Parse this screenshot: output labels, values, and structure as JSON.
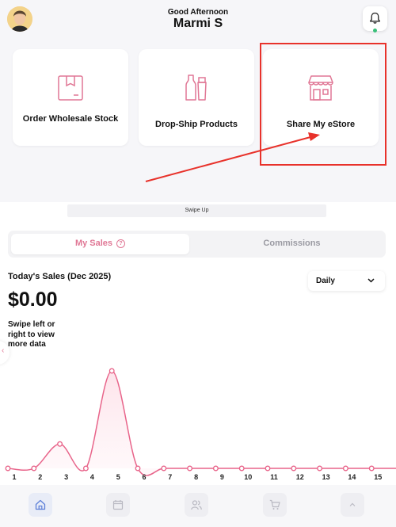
{
  "header": {
    "greeting": "Good Afternoon",
    "user_name": "Marmi S",
    "notification_status": "online"
  },
  "quick_actions": [
    {
      "label": "Order Wholesale Stock",
      "icon": "box-icon"
    },
    {
      "label": "Drop-Ship Products",
      "icon": "bottles-icon"
    },
    {
      "label": "Share My eStore",
      "icon": "storefront-icon"
    }
  ],
  "swipe_up_label": "Swipe Up",
  "tabs": {
    "active": "My Sales",
    "inactive": "Commissions",
    "help_glyph": "?"
  },
  "sales": {
    "title": "Today's Sales (Dec 2025)",
    "amount": "$0.00",
    "hint": "Swipe left or right to view more data",
    "period": "Daily"
  },
  "chart_data": {
    "type": "line",
    "x": [
      1,
      2,
      3,
      4,
      5,
      6,
      7,
      8,
      9,
      10,
      11,
      12,
      13,
      14,
      15
    ],
    "series": [
      {
        "values": [
          0,
          0,
          0.25,
          0,
          1,
          0,
          0,
          0,
          0,
          0,
          0,
          0,
          0,
          0,
          0
        ]
      }
    ],
    "ticks": [
      "1",
      "2",
      "3",
      "4",
      "5",
      "6",
      "7",
      "8",
      "9",
      "10",
      "11",
      "12",
      "13",
      "14",
      "15"
    ],
    "color": "#e8648a",
    "fill": "#fde3ea"
  },
  "colors": {
    "accent": "#e07795",
    "annotation": "#e8322b",
    "status_dot": "#39c07a"
  },
  "nav": [
    "home-icon",
    "calendar-icon",
    "users-icon",
    "cart-icon",
    "chevron-up-icon"
  ]
}
